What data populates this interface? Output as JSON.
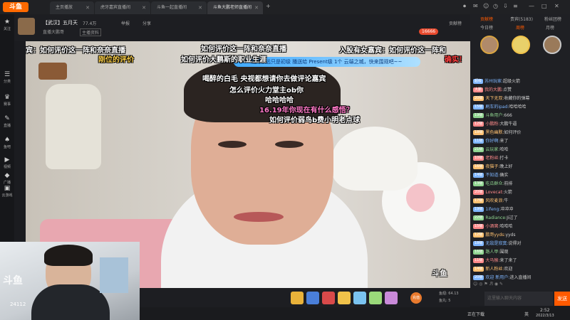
{
  "browser": {
    "tabs": [
      {
        "label": "主页播放",
        "active": false
      },
      {
        "label": "虎牙嘉宾直播间",
        "active": false
      },
      {
        "label": "斗鱼一起直播间",
        "active": false
      },
      {
        "label": "斗鱼大鹏老师直播间",
        "active": true
      }
    ],
    "new_tab": "+",
    "window_controls": [
      "—",
      "□",
      "✕"
    ]
  },
  "logo_text": "斗鱼",
  "left_nav": [
    {
      "icon": "★",
      "label": "关注"
    },
    {
      "icon": "☰",
      "label": "分类"
    },
    {
      "icon": "♛",
      "label": "赛事"
    },
    {
      "icon": "✎",
      "label": "直播"
    },
    {
      "icon": "♠",
      "label": "鱼吧"
    },
    {
      "icon": "▶",
      "label": "视频"
    },
    {
      "icon": "◆",
      "label": "广播"
    },
    {
      "icon": "▣",
      "label": "云游戏"
    }
  ],
  "room": {
    "title": "【武汉】五月天",
    "host_label": "直播大鹏哥",
    "tag": "主播资料",
    "viewers": "77.4万",
    "follow_label": "已经关注",
    "follow_count": "16666",
    "report": "举报",
    "share": "分享",
    "rank_label": "贡献榜"
  },
  "banner_text": "烧烤永远只是初级 播送给 Present级 1个 云端之城，快来围观吧~~",
  "danmu": [
    {
      "text": "如何评价这一阵和奈奈直播",
      "style": "w",
      "cls": "d1"
    },
    {
      "text": "女嘉宾：如何评价这一阵和奈奈直播",
      "style": "w",
      "cls": "d2"
    },
    {
      "text": "入股有女嘉宾：如何评价这一阵和",
      "style": "w",
      "cls": "d3"
    },
    {
      "text": "刚位的评价",
      "style": "y",
      "cls": "d4"
    },
    {
      "text": "如何评价大鹏斯的职业生涯",
      "style": "w",
      "cls": "d5"
    },
    {
      "text": "喝醉的白毛 央视都想请你去做评论嘉宾",
      "style": "w",
      "cls": "d6"
    },
    {
      "text": "怎么评价火力堂主ob你",
      "style": "w",
      "cls": "d7"
    },
    {
      "text": "哈哈哈哈",
      "style": "w",
      "cls": "d8"
    },
    {
      "text": "16.19年你现在有什么感悟？",
      "style": "p",
      "cls": "d9"
    },
    {
      "text": "如何评价弱鸟b费小明老点球",
      "style": "w",
      "cls": "d10"
    },
    {
      "text": "确实！",
      "style": "r",
      "cls": "d11"
    },
    {
      "text": "斗鱼",
      "style": "w",
      "cls": "d12"
    }
  ],
  "gift_bar": {
    "items": [
      "火箭",
      "飞机",
      "办卡",
      "荧光棒",
      "鱼丸",
      "弹幕卡",
      "超级弹幕"
    ],
    "side_label": "充值",
    "balance": "鱼翅: 64.13",
    "fish_ball": "鱼丸: 5"
  },
  "right_panel": {
    "tabs": [
      {
        "label": "贡献榜",
        "active": true
      },
      {
        "label": "贵宾(5183)",
        "active": false
      },
      {
        "label": "粉丝团榜",
        "active": false
      }
    ],
    "subtabs": [
      "今日榜",
      "周榜",
      "月榜"
    ],
    "chat": [
      {
        "badge": "超级",
        "name": "苏州玩家:",
        "msg": "超级火箭",
        "color": "#7fb6ff"
      },
      {
        "badge": "大鹏",
        "name": "我的大鹏:",
        "msg": "点赞",
        "color": "#ff8a8a"
      },
      {
        "badge": "20级",
        "name": "天下无双:",
        "msg": "收藏你的弹幕",
        "color": "#ffc070"
      },
      {
        "badge": "15级",
        "name": "刷车的ipad:",
        "msg": "哈哈哈哈",
        "color": "#7fb6ff"
      },
      {
        "badge": "19级",
        "name": "斗鱼用户:",
        "msg": "666",
        "color": "#8fd48f"
      },
      {
        "badge": "12级",
        "name": "小鹏粉:",
        "msg": "大鹏牛逼",
        "color": "#ff8a8a"
      },
      {
        "badge": "18级",
        "name": "黑色幽默:",
        "msg": "如何评价",
        "color": "#ffc070"
      },
      {
        "badge": "11级",
        "name": "你好啊:",
        "msg": "来了",
        "color": "#7fb6ff"
      },
      {
        "badge": "21级",
        "name": "云玩家:",
        "msg": "哈哈",
        "color": "#8fd48f"
      },
      {
        "badge": "10级",
        "name": "老粉丝:",
        "msg": "打卡",
        "color": "#ff8a8a"
      },
      {
        "badge": "16级",
        "name": "夜猫子:",
        "msg": "晚上好",
        "color": "#ffc070"
      },
      {
        "badge": "14级",
        "name": "不知道:",
        "msg": "确实",
        "color": "#7fb6ff"
      },
      {
        "badge": "13级",
        "name": "吃瓜群众:",
        "msg": "前排",
        "color": "#8fd48f"
      },
      {
        "badge": "20级",
        "name": "Lovecat:",
        "msg": "火箭",
        "color": "#ff8a8a"
      },
      {
        "badge": "17级",
        "name": "风吹麦浪:",
        "msg": "牛",
        "color": "#ffc070"
      },
      {
        "badge": "19级",
        "name": "1ifeng:",
        "msg": "冲冲冲",
        "color": "#7fb6ff"
      },
      {
        "badge": "22级",
        "name": "Radiance:",
        "msg": "Ji过了",
        "color": "#8fd48f"
      },
      {
        "badge": "15级",
        "name": "小酒窝:",
        "msg": "哈哈哈",
        "color": "#ff8a8a"
      },
      {
        "badge": "12级",
        "name": "鹏哥yyds:",
        "msg": "yyds",
        "color": "#ffc070"
      },
      {
        "badge": "18级",
        "name": "无敌是寂寞:",
        "msg": "说得对",
        "color": "#7fb6ff"
      },
      {
        "badge": "16级",
        "name": "路人甲:",
        "msg": "围观",
        "color": "#8fd48f"
      },
      {
        "badge": "11级",
        "name": "大马猴:",
        "msg": "来了来了",
        "color": "#ff8a8a"
      },
      {
        "badge": "14级",
        "name": "新人粉丝:",
        "msg": "欢迎",
        "color": "#ffc070"
      },
      {
        "badge": "20级",
        "name": "欢迎 新用户:",
        "msg": "进入直播间",
        "color": "#7fb6ff"
      }
    ],
    "input_placeholder": "这里输入聊天内容",
    "send_label": "发送"
  },
  "webcam_time": "24112",
  "webcam_logo": "斗鱼",
  "taskbar": {
    "status": "正在下载",
    "time": "2:52",
    "date": "2022/3/13",
    "lang": "英"
  }
}
